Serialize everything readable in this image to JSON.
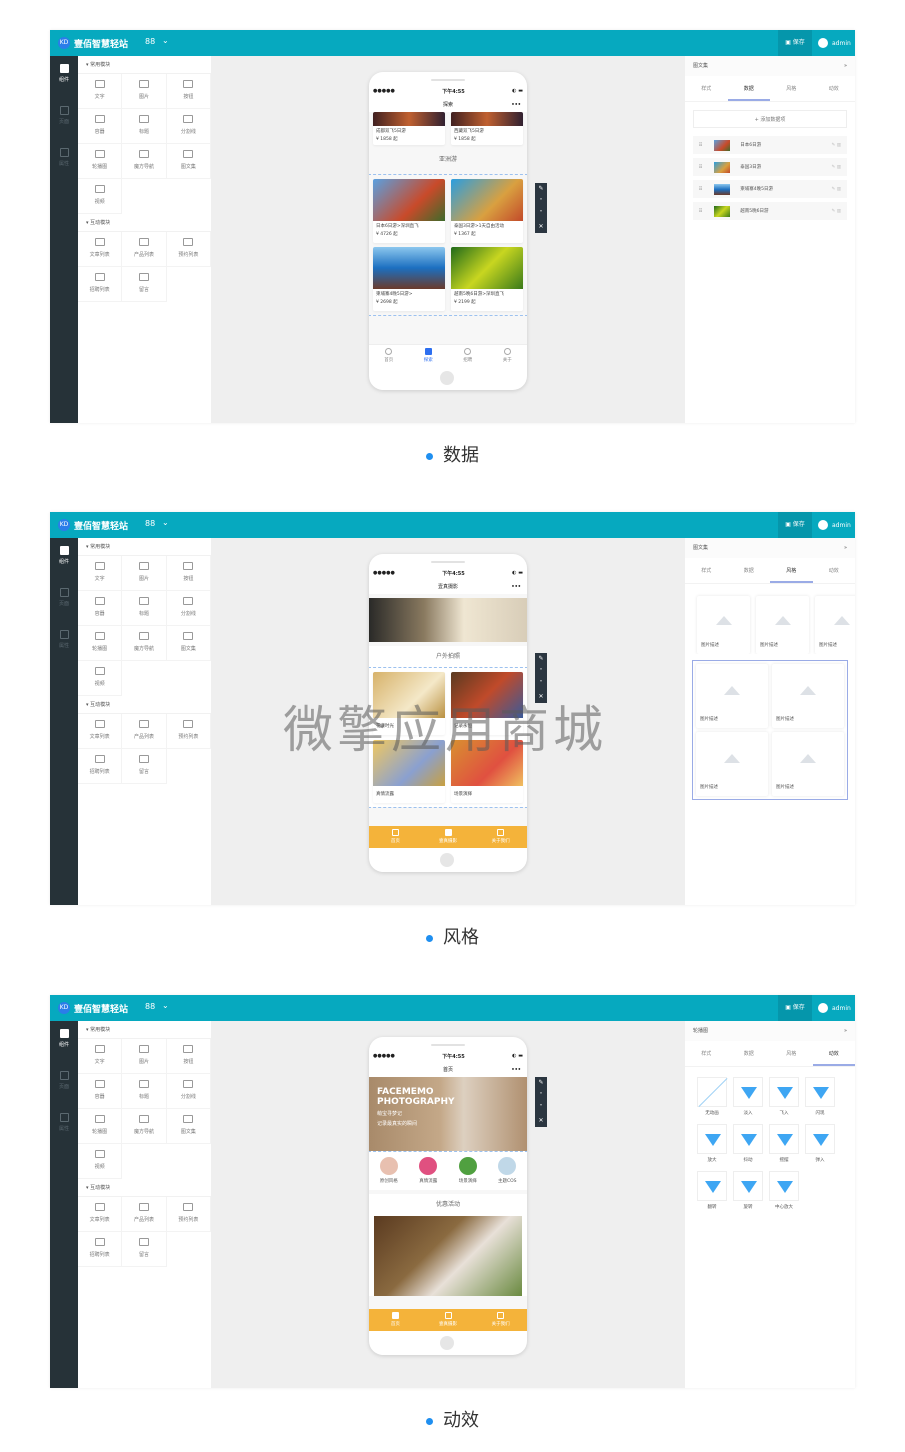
{
  "app": {
    "title": "壹佰智慧轻站",
    "logo": "KD",
    "grid_icon": "88",
    "save": "保存",
    "user": "admin"
  },
  "rail": [
    "组件",
    "页面",
    "属性"
  ],
  "component_groups": [
    {
      "title": "常用模块",
      "items": [
        "文字",
        "图片",
        "按钮",
        "容器",
        "标题",
        "分割线",
        "轮播图",
        "魔方导航",
        "图文集",
        "视频"
      ]
    },
    {
      "title": "互动模块",
      "items": [
        "文章列表",
        "产品列表",
        "预约列表",
        "招聘列表",
        "留言"
      ]
    }
  ],
  "phone_status": {
    "signal": "●●●●●",
    "time": "下午4:55",
    "dots": "•••"
  },
  "right_tabs": [
    "样式",
    "数据",
    "风格",
    "动效"
  ],
  "toolbar": [
    "✎",
    "˄",
    "˅",
    "✕"
  ],
  "panels": [
    {
      "caption": "数据",
      "nav_title": "探索",
      "right_title": "图文集",
      "active_tab": 1,
      "top_cards": [
        {
          "title": "成都双飞5日游",
          "price": "¥ 1858 起"
        },
        {
          "title": "西藏双飞5日游",
          "price": "¥ 1858 起"
        }
      ],
      "section": "亚洲游",
      "cards": [
        {
          "title": "日本6日游>深圳直飞",
          "price": "¥ 4726 起"
        },
        {
          "title": "泰国3日游>1天自由活动",
          "price": "¥ 1367 起"
        },
        {
          "title": "柬埔寨4晚5日游>",
          "price": "¥ 2698 起"
        },
        {
          "title": "越南5晚6日游>深圳直飞",
          "price": "¥ 2199 起"
        }
      ],
      "tabbar": [
        "首页",
        "探索",
        "招聘",
        "关于"
      ],
      "tab_active": 1,
      "add_label": "+ 添加数据项",
      "data_items": [
        "日本6日游",
        "泰国3日游",
        "柬埔寨4晚5日游",
        "越南5晚6日游"
      ]
    },
    {
      "caption": "风格",
      "nav_title": "壹真摄影",
      "right_title": "图文集",
      "active_tab": 2,
      "section": "户外拍照",
      "cards": [
        {
          "title": "花漾时光"
        },
        {
          "title": "记录永恒"
        },
        {
          "title": "真情流露"
        },
        {
          "title": "场景演绎"
        }
      ],
      "tabbar": [
        "首页",
        "壹真摄影",
        "关于我们"
      ],
      "tab_active": 1,
      "style_label": "图片描述"
    },
    {
      "caption": "动效",
      "nav_title": "首页",
      "right_title": "轮播图",
      "active_tab": 3,
      "banner": {
        "line1": "FACEMEMO",
        "line2": "PHOTOGRAPHY",
        "line3": "萌宝寻梦记",
        "line4": "记录最真实的瞬间"
      },
      "icons": [
        "原创风格",
        "真情流露",
        "场景演绎",
        "主题COS"
      ],
      "section": "优惠活动",
      "tabbar": [
        "首页",
        "壹真摄影",
        "关于我们"
      ],
      "tab_active": 0,
      "animations": [
        "无动画",
        "淡入",
        "飞入",
        "闪现",
        "放大",
        "抖动",
        "摇摆",
        "弹入",
        "翻转",
        "旋转",
        "中心放大"
      ]
    }
  ],
  "watermark": "微擎应用商城",
  "colors": {
    "header": "#06a9bf",
    "rail": "#263238",
    "accent": "#2d6ff0",
    "orange_tabbar": "#f4b33a",
    "bullet": "#1f8ff0"
  }
}
